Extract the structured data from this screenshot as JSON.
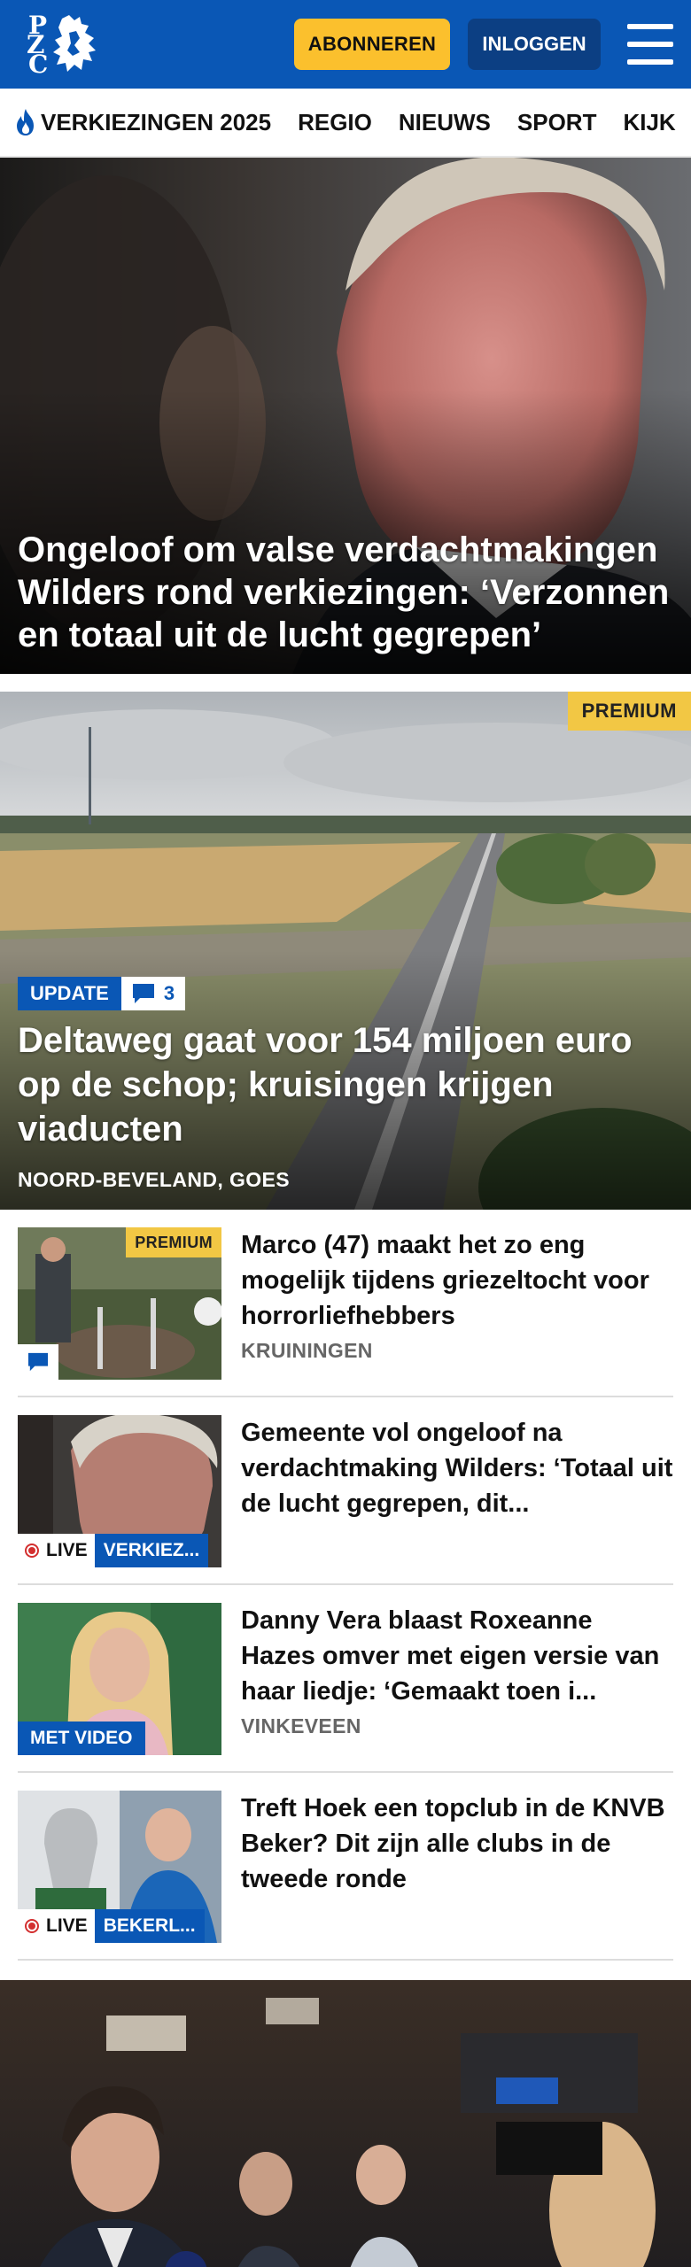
{
  "header": {
    "logo_letters": [
      "P",
      "Z",
      "C"
    ],
    "subscribe_label": "ABONNEREN",
    "login_label": "INLOGGEN",
    "brand_color": "#0a57b5",
    "subscribe_color": "#fbc02d"
  },
  "nav": {
    "items": [
      {
        "label": "VERKIEZINGEN 2025",
        "icon": "flame-icon"
      },
      {
        "label": "REGIO"
      },
      {
        "label": "NIEUWS"
      },
      {
        "label": "SPORT"
      },
      {
        "label": "KIJK"
      }
    ]
  },
  "hero1": {
    "headline": "Ongeloof om valse verdachtmakingen Wilders rond verkiezingen: ‘Verzonnen en totaal uit de lucht gegrepen’"
  },
  "hero2": {
    "premium": "PREMIUM",
    "update": "UPDATE",
    "comment_count": "3",
    "headline": "Deltaweg gaat voor 154 miljoen euro op de schop; kruisingen krijgen viaducten",
    "location": "NOORD-BEVELAND, GOES"
  },
  "list": [
    {
      "title": "Marco (47) maakt het zo eng mogelijk tijdens griezeltocht voor horrorliefhebbers",
      "location": "KRUININGEN",
      "premium": "PREMIUM"
    },
    {
      "title": "Gemeente vol ongeloof na verdachtmaking Wilders: ‘Totaal uit de lucht gegrepen, dit...",
      "live": "LIVE",
      "category": "VERKIEZ..."
    },
    {
      "title": "Danny Vera blaast Roxeanne Hazes omver met eigen versie van haar liedje: ‘Gemaakt toen i...",
      "location": "VINKEVEEN",
      "video": "MET VIDEO"
    },
    {
      "title": "Treft Hoek een topclub in de KNVB Beker? Dit zijn alle clubs in de tweede ronde",
      "live": "LIVE",
      "category": "BEKERL..."
    }
  ]
}
